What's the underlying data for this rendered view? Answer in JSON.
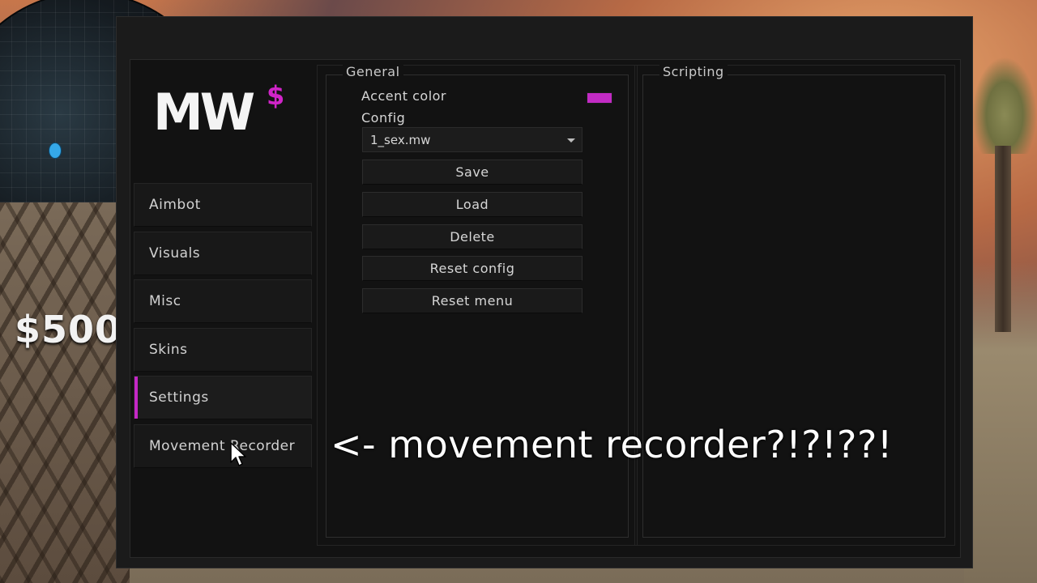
{
  "hud": {
    "money": "$500"
  },
  "menu": {
    "logo": {
      "text": "MW",
      "mark": "$"
    },
    "nav": [
      {
        "label": "Aimbot",
        "active": false
      },
      {
        "label": "Visuals",
        "active": false
      },
      {
        "label": "Misc",
        "active": false
      },
      {
        "label": "Skins",
        "active": false
      },
      {
        "label": "Settings",
        "active": true
      },
      {
        "label": "Movement Recorder",
        "active": false
      }
    ],
    "general": {
      "title": "General",
      "accent_label": "Accent color",
      "accent_color": "#c22bc4",
      "config_label": "Config",
      "config_value": "1_sex.mw",
      "buttons": [
        "Save",
        "Load",
        "Delete",
        "Reset config",
        "Reset menu"
      ]
    },
    "scripting": {
      "title": "Scripting"
    }
  },
  "overlay_caption": "<- movement recorder?!?!??!",
  "icons": [
    "radar-icon",
    "player-marker-icon",
    "chevron-down-icon",
    "mouse-cursor-icon"
  ]
}
